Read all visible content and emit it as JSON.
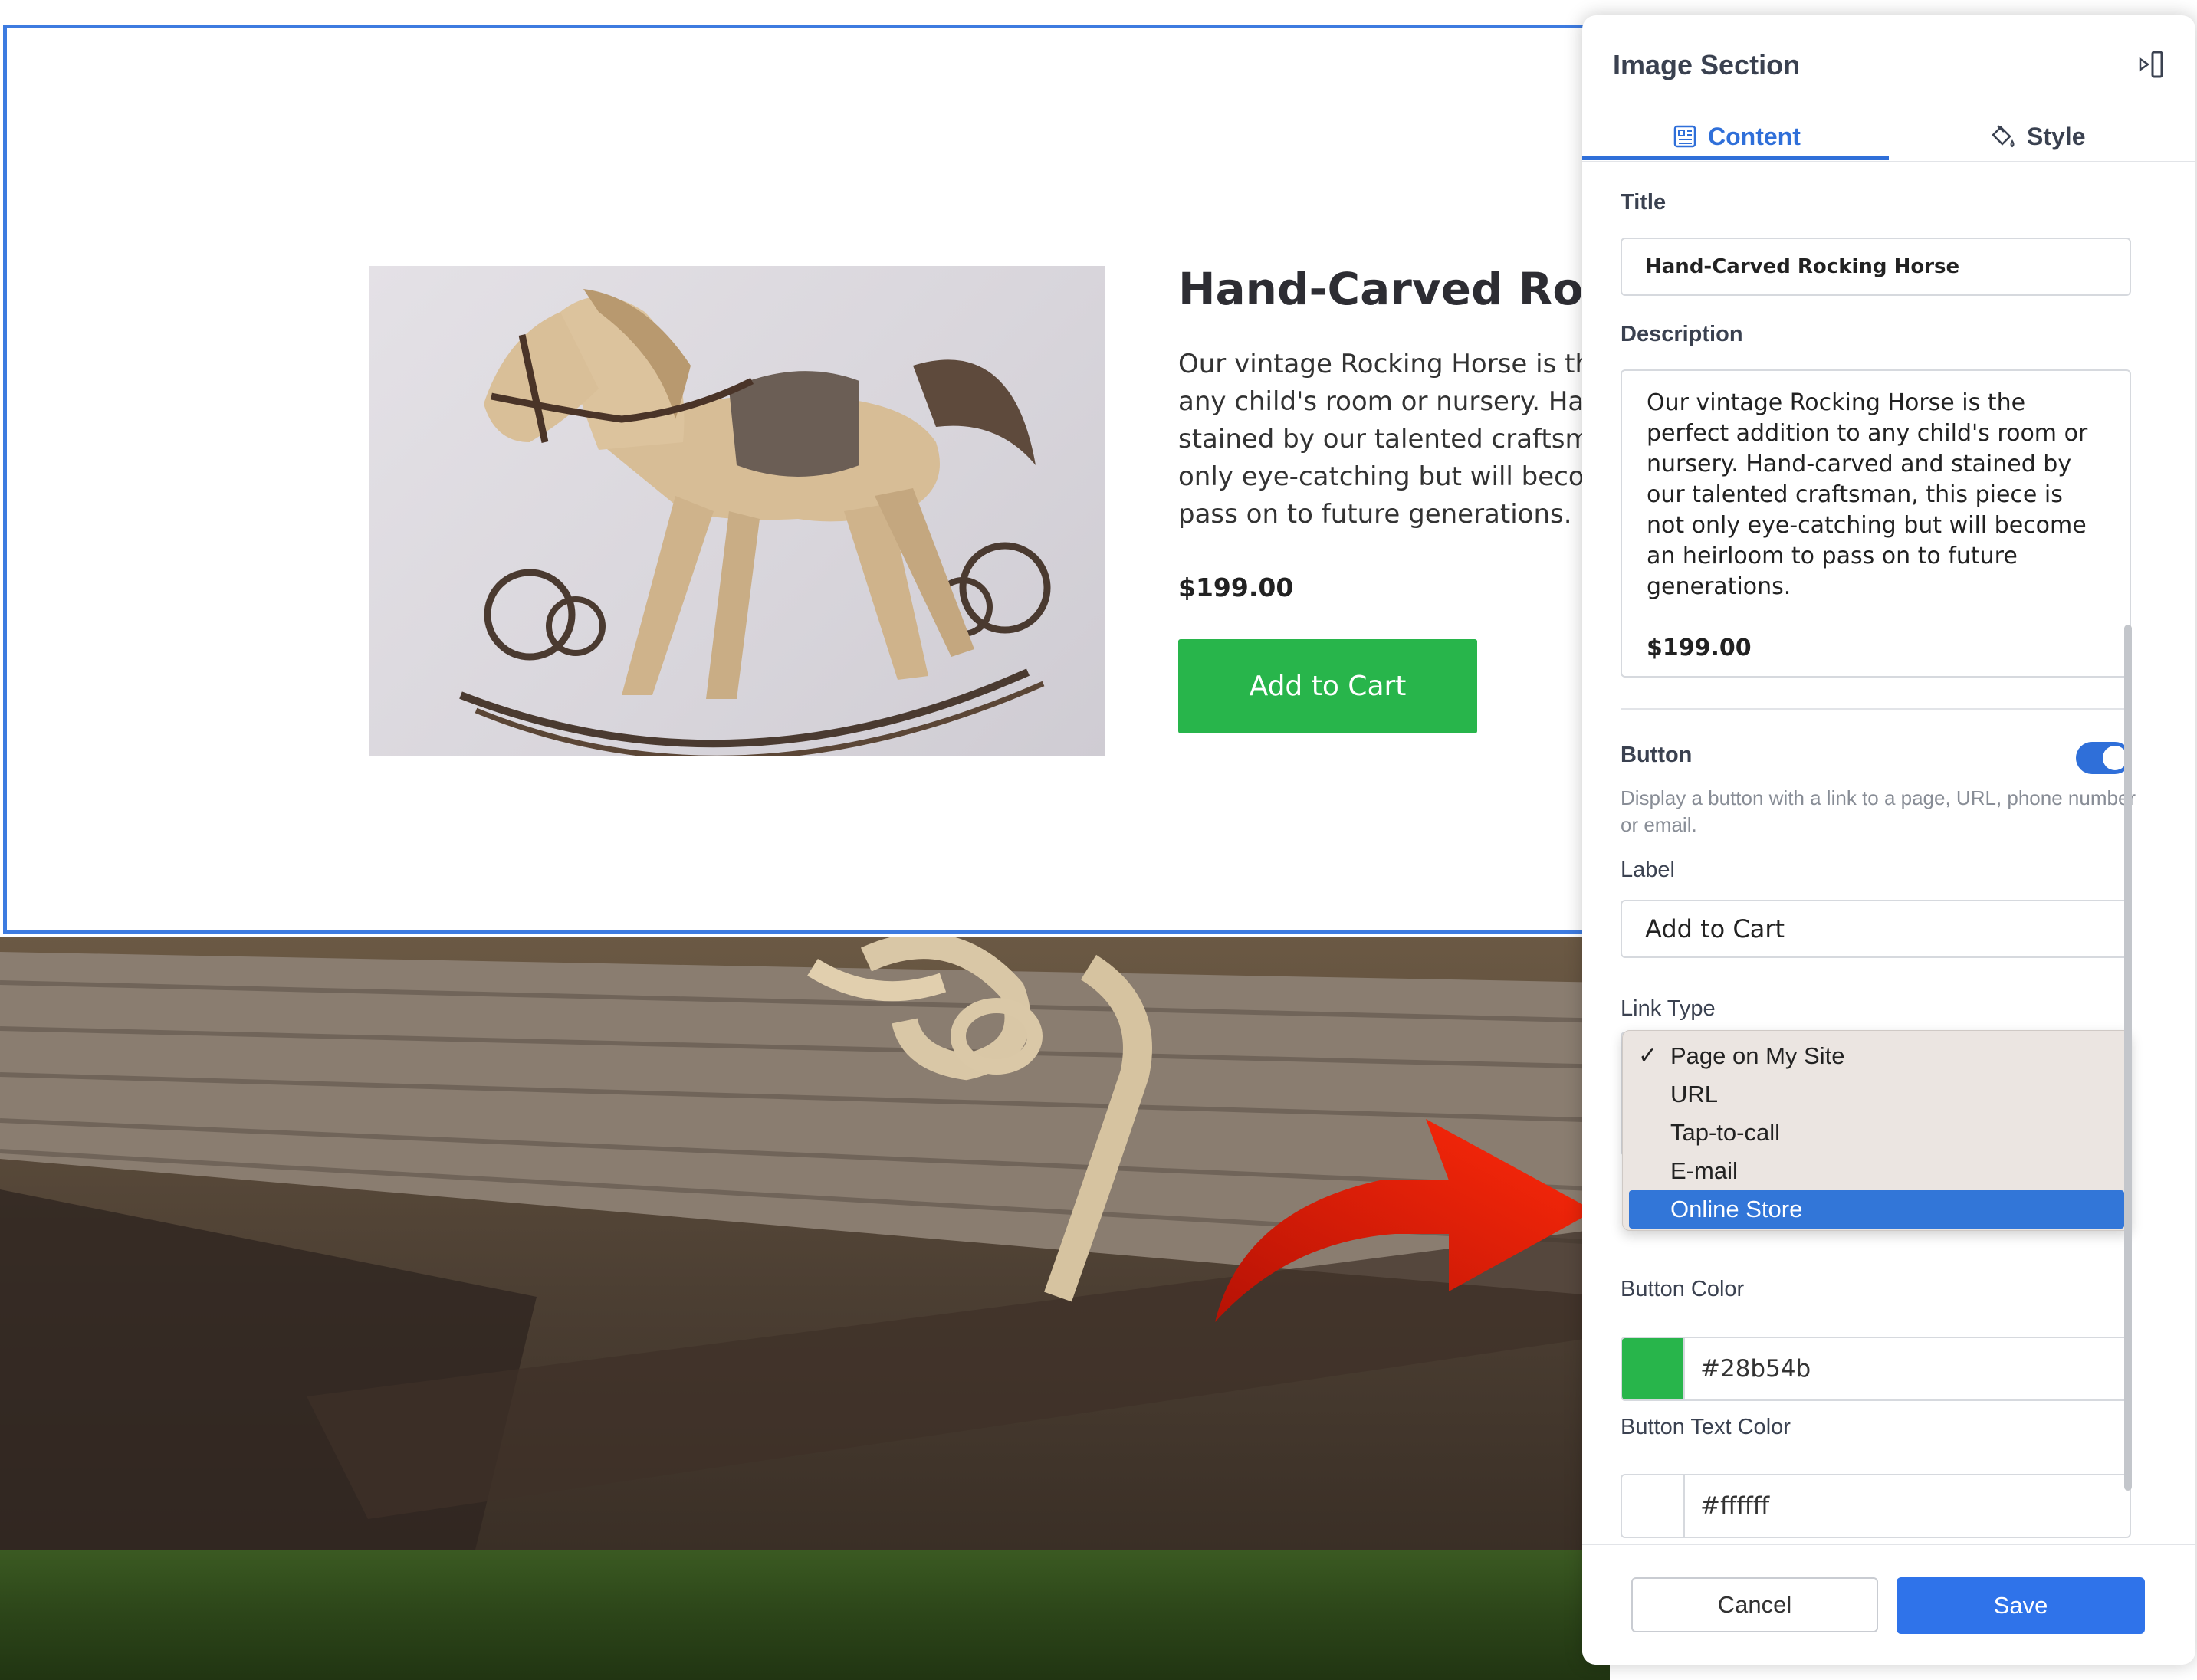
{
  "product": {
    "title": "Hand-Carved Rock",
    "description": "Our vintage Rocking Horse is the perfect addition to any child's room or nursery. Hand-carved and stained by our talented craftsman, this piece is not only eye-catching but will become an heirloom to pass on to future generations.",
    "description_lines": [
      "Our vintage Rocking Horse is the",
      "any child's room or nursery. Hanc",
      "stained by our talented craftsman",
      "only eye-catching but will become",
      "pass on to future generations."
    ],
    "price": "$199.00",
    "button_label": "Add to Cart",
    "button_color": "#28b54b"
  },
  "panel": {
    "title": "Image Section",
    "tabs": [
      {
        "label": "Content",
        "active": true,
        "icon": "content-icon"
      },
      {
        "label": "Style",
        "active": false,
        "icon": "paint-bucket-icon"
      }
    ],
    "fields": {
      "title_label": "Title",
      "title_value": "Hand-Carved Rocking Horse",
      "description_label": "Description",
      "description_value": "Our vintage Rocking Horse is the perfect addition to any child's room or nursery. Hand-carved and stained by our talented craftsman, this piece is not only eye-catching but will become an heirloom to pass on to future generations.",
      "description_price": "$199.00",
      "button_heading": "Button",
      "button_enabled": true,
      "button_help": "Display a button with a link to a page, URL, phone number or email.",
      "label_label": "Label",
      "label_value": "Add to Cart",
      "link_type_label": "Link Type",
      "link_type_options": [
        {
          "label": "Page on My Site",
          "checked": true,
          "highlighted": false
        },
        {
          "label": "URL",
          "checked": false,
          "highlighted": false
        },
        {
          "label": "Tap-to-call",
          "checked": false,
          "highlighted": false
        },
        {
          "label": "E-mail",
          "checked": false,
          "highlighted": false
        },
        {
          "label": "Online Store",
          "checked": false,
          "highlighted": true
        }
      ],
      "button_color_label": "Button Color",
      "button_color_value": "#28b54b",
      "button_text_color_label": "Button Text Color",
      "button_text_color_value": "#ffffff"
    },
    "footer": {
      "cancel_label": "Cancel",
      "save_label": "Save"
    }
  },
  "colors": {
    "accent": "#2f6fd9",
    "save": "#2f73ea",
    "selection_border": "#3d7be0",
    "arrow": "#f0200a"
  }
}
